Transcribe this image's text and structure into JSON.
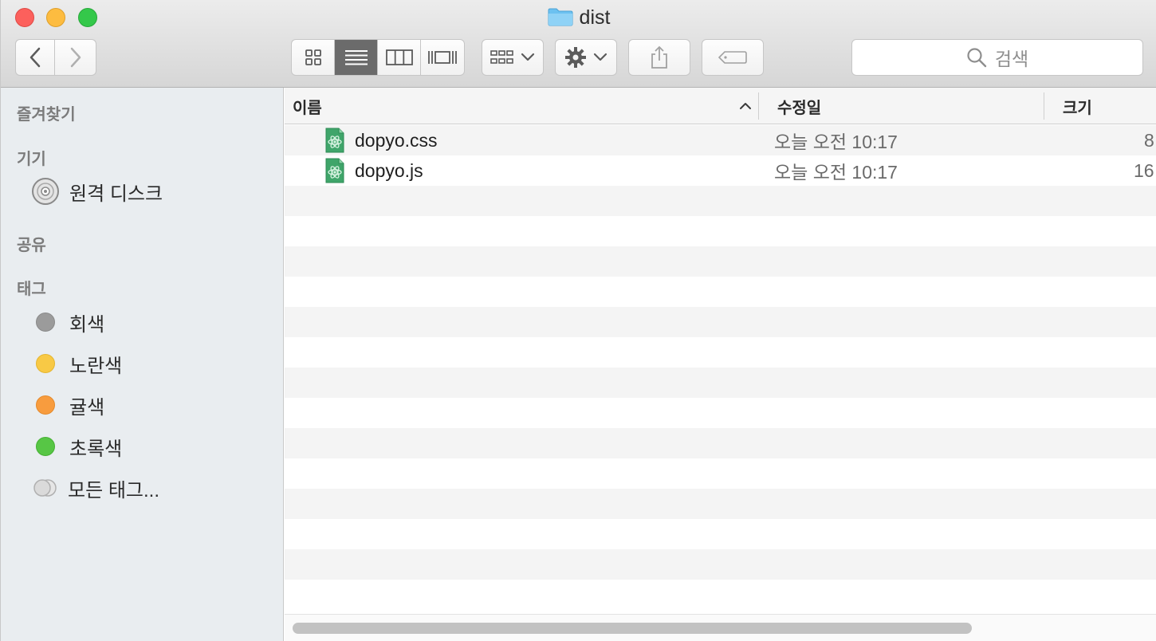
{
  "window": {
    "title": "dist",
    "title_icon": "folder-icon"
  },
  "toolbar": {
    "back_icon": "chevron-left-icon",
    "forward_icon": "chevron-right-icon",
    "view_modes": [
      "icon-view",
      "list-view",
      "column-view",
      "cover-flow-view"
    ],
    "active_view": "list-view",
    "arrange_icon": "arrange-grid-icon",
    "action_icon": "gear-icon",
    "share_icon": "share-icon",
    "tag_icon": "tag-icon",
    "search_placeholder": "검색"
  },
  "sidebar": {
    "favorites_label": "즐겨찾기",
    "devices_label": "기기",
    "devices": [
      {
        "label": "원격 디스크",
        "icon": "disc-icon"
      }
    ],
    "shared_label": "공유",
    "tags_label": "태그",
    "tags": [
      {
        "label": "회색",
        "color": "#9b9b9b"
      },
      {
        "label": "노란색",
        "color": "#f8c945"
      },
      {
        "label": "귤색",
        "color": "#f89c3e"
      },
      {
        "label": "초록색",
        "color": "#57c645"
      },
      {
        "label": "모든 태그...",
        "color": "#d9d9d9"
      }
    ]
  },
  "columns": {
    "name": "이름",
    "modified": "수정일",
    "size": "크기"
  },
  "files": [
    {
      "name": "dopyo.css",
      "modified": "오늘 오전 10:17",
      "size": "8",
      "icon": "atom-file-icon"
    },
    {
      "name": "dopyo.js",
      "modified": "오늘 오전 10:17",
      "size": "16",
      "icon": "atom-file-icon"
    }
  ],
  "colors": {
    "sidebar_bg": "#e9edf0",
    "toolbar_bg": "#dcdcdc",
    "row_alt": "#f4f4f4",
    "active_segment": "#6b6b6b"
  }
}
